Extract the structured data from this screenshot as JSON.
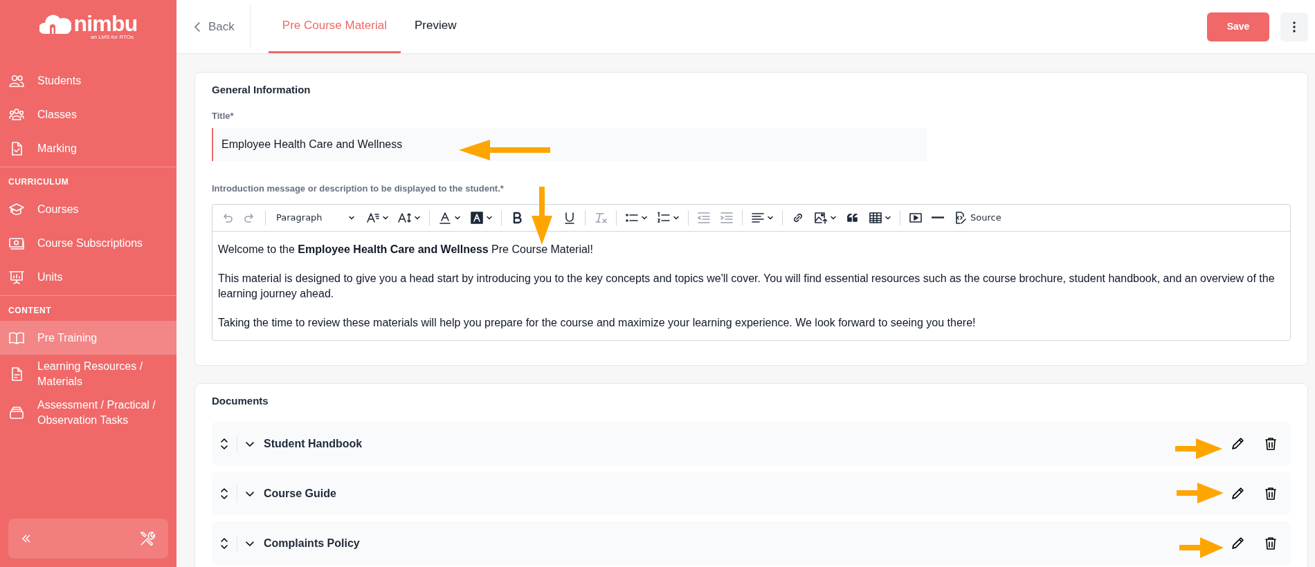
{
  "sidebar": {
    "logo": {
      "name": "nimbu",
      "tagline": "an LMS for RTOs"
    },
    "sections": [
      {
        "items": [
          {
            "label": "Students",
            "selected": false
          },
          {
            "label": "Classes",
            "selected": false
          },
          {
            "label": "Marking",
            "selected": false
          }
        ]
      },
      {
        "heading": "CURRICULUM",
        "items": [
          {
            "label": "Courses",
            "selected": false
          },
          {
            "label": "Course Subscriptions",
            "selected": false
          },
          {
            "label": "Units",
            "selected": false
          }
        ]
      },
      {
        "heading": "CONTENT",
        "items": [
          {
            "label": "Pre Training",
            "selected": true
          },
          {
            "label": "Learning Resources / Materials",
            "selected": false
          },
          {
            "label": "Assessment / Practical / Observation Tasks",
            "selected": false
          }
        ]
      }
    ]
  },
  "header": {
    "back": "Back",
    "tabs": [
      {
        "label": "Pre Course Material",
        "selected": true
      },
      {
        "label": "Preview",
        "selected": false
      }
    ],
    "save": "Save"
  },
  "general_information": {
    "heading": "General Information",
    "title_field": {
      "label": "Title*",
      "value": "Employee Health Care and Wellness"
    },
    "description": {
      "label": "Introduction message or description to be displayed to the student.*",
      "toolbar": {
        "block_format": "Paragraph",
        "source": "Source"
      },
      "paragraphs": [
        "Welcome to the **Employee Health Care and Wellness** Pre Course Material!",
        "This material is designed to give you a head start by introducing you to the key concepts and topics we'll cover. You will find essential resources such as the course brochure, student handbook, and an overview of the learning journey ahead.",
        "Taking the time to review these materials will help you prepare for the course and maximize your learning experience. We look forward to seeing you there!"
      ]
    }
  },
  "documents": {
    "heading": "Documents",
    "items": [
      {
        "name": "Student Handbook"
      },
      {
        "name": "Course Guide"
      },
      {
        "name": "Complaints Policy"
      }
    ]
  }
}
